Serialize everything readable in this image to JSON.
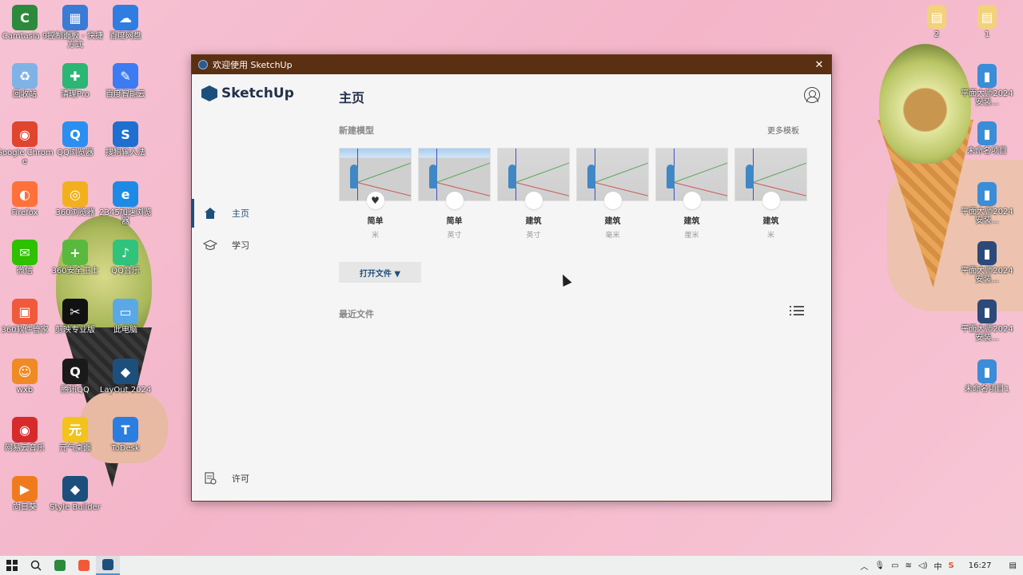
{
  "desktop": {
    "left_icons": [
      {
        "label": "Camtasia 9",
        "color": "#2c8a3c",
        "glyph": "C"
      },
      {
        "label": "控制面板 - 快捷方式",
        "color": "#3a7bd5",
        "glyph": "▦"
      },
      {
        "label": "百度网盘",
        "color": "#2f7de1",
        "glyph": "☁"
      },
      {
        "label": "回收站",
        "color": "#7fb3e6",
        "glyph": "♻"
      },
      {
        "label": "清理Pro",
        "color": "#2bb673",
        "glyph": "✚"
      },
      {
        "label": "百度智能云",
        "color": "#3c7bf2",
        "glyph": "✎"
      },
      {
        "label": "Google Chrome",
        "color": "#e0452f",
        "glyph": "◉"
      },
      {
        "label": "QQ浏览器",
        "color": "#2a8ff0",
        "glyph": "Q"
      },
      {
        "label": "搜狗输入法",
        "color": "#1f6fd1",
        "glyph": "S"
      },
      {
        "label": "Firefox",
        "color": "#ff7139",
        "glyph": "◐"
      },
      {
        "label": "360浏览器",
        "color": "#f2b01e",
        "glyph": "◎"
      },
      {
        "label": "2345加速浏览器",
        "color": "#1d8ae6",
        "glyph": "e"
      },
      {
        "label": "微信",
        "color": "#2dc100",
        "glyph": "✉"
      },
      {
        "label": "360安全卫士",
        "color": "#59b93f",
        "glyph": "+"
      },
      {
        "label": "QQ音乐",
        "color": "#31c27c",
        "glyph": "♪"
      },
      {
        "label": "360软件管家",
        "color": "#f05a3a",
        "glyph": "▣"
      },
      {
        "label": "剪映专业版",
        "color": "#111111",
        "glyph": "✂"
      },
      {
        "label": "此电脑",
        "color": "#5aa9e6",
        "glyph": "▭"
      },
      {
        "label": "wxb",
        "color": "#f08a24",
        "glyph": "☺"
      },
      {
        "label": "腾讯QQ",
        "color": "#1a1a1a",
        "glyph": "Q"
      },
      {
        "label": "LayOut 2024",
        "color": "#1d4f7c",
        "glyph": "◆"
      },
      {
        "label": "网易云音乐",
        "color": "#d72b2b",
        "glyph": "◉"
      },
      {
        "label": "元气桌面",
        "color": "#f2c31b",
        "glyph": "元"
      },
      {
        "label": "ToDesk",
        "color": "#2a7de1",
        "glyph": "T"
      },
      {
        "label": "向日葵",
        "color": "#f07b1f",
        "glyph": "▶"
      },
      {
        "label": "Style Builder",
        "color": "#1d4f7c",
        "glyph": "◆"
      }
    ],
    "right_icons": [
      {
        "label": "2",
        "color": "#f2d27a",
        "glyph": "▤"
      },
      {
        "label": "1",
        "color": "#f2d27a",
        "glyph": "▤"
      },
      {
        "label": "平面大师2024 安装...",
        "color": "#3b8dd8",
        "glyph": "▮"
      },
      {
        "label": "未命名项目",
        "color": "#3b8dd8",
        "glyph": "▮"
      },
      {
        "label": "平面大师2024 安装...",
        "color": "#3b8dd8",
        "glyph": "▮"
      },
      {
        "label": "平面大师2024 安装...",
        "color": "#2b4a7a",
        "glyph": "▮"
      },
      {
        "label": "平面大师2024 安装...",
        "color": "#2b4a7a",
        "glyph": "▮"
      },
      {
        "label": "未命名项目1",
        "color": "#3b8dd8",
        "glyph": "▮"
      }
    ]
  },
  "window": {
    "title": "欢迎使用 SketchUp",
    "close": "✕",
    "logo": "SketchUp",
    "nav": {
      "home": "主页",
      "learn": "学习",
      "license": "许可"
    },
    "page_title": "主页",
    "new_model_label": "新建模型",
    "more_templates": "更多模板",
    "templates": [
      {
        "name": "简单",
        "unit": "米",
        "favorite": true
      },
      {
        "name": "简单",
        "unit": "英寸",
        "favorite": false
      },
      {
        "name": "建筑",
        "unit": "英寸",
        "favorite": false
      },
      {
        "name": "建筑",
        "unit": "毫米",
        "favorite": false
      },
      {
        "name": "建筑",
        "unit": "厘米",
        "favorite": false
      },
      {
        "name": "建筑",
        "unit": "米",
        "favorite": false
      }
    ],
    "open_file": "打开文件 ▼",
    "recent_label": "最近文件"
  },
  "taskbar": {
    "tray_input": "中",
    "clock": "16:27",
    "apps": [
      {
        "name": "camtasia",
        "color": "#2c8a3c"
      },
      {
        "name": "recorder",
        "color": "#f05a3a"
      },
      {
        "name": "sketchup",
        "color": "#1d4f7c"
      }
    ]
  }
}
